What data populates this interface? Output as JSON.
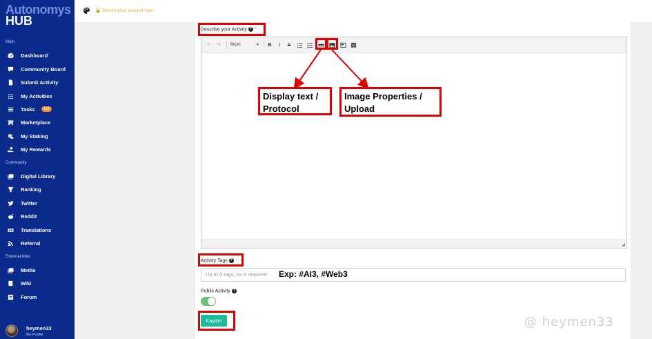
{
  "brand": {
    "line1": "Autonomys",
    "line2": "HUB"
  },
  "topbar": {
    "secure_text": "Secure your account now"
  },
  "sidebar": {
    "sections": {
      "main": "Main",
      "community": "Community",
      "external": "External links"
    },
    "items": [
      {
        "label": "Dashboard",
        "icon": "speedometer-icon"
      },
      {
        "label": "Community Board",
        "icon": "chat-icon"
      },
      {
        "label": "Submit Activity",
        "icon": "file-icon"
      },
      {
        "label": "My Activities",
        "icon": "list-icon"
      },
      {
        "label": "Tasks",
        "icon": "tasks-icon",
        "badge": "112"
      },
      {
        "label": "Marketplace",
        "icon": "store-icon"
      },
      {
        "label": "My Staking",
        "icon": "coins-icon"
      },
      {
        "label": "My Rewards",
        "icon": "hand-coin-icon"
      },
      {
        "label": "Digital Library",
        "icon": "photo-icon"
      },
      {
        "label": "Ranking",
        "icon": "trophy-icon"
      },
      {
        "label": "Twitter",
        "icon": "twitter-icon"
      },
      {
        "label": "Reddit",
        "icon": "reddit-icon"
      },
      {
        "label": "Translations",
        "icon": "translate-icon"
      },
      {
        "label": "Referral",
        "icon": "rss-icon"
      },
      {
        "label": "Media",
        "icon": "photo-icon"
      },
      {
        "label": "Wiki",
        "icon": "book-icon"
      },
      {
        "label": "Forum",
        "icon": "forum-icon"
      }
    ],
    "profile": {
      "name": "heymen33",
      "sub": "My Profile"
    }
  },
  "form": {
    "describe_label": "Describe your Activity",
    "required_mark": "*",
    "format_select": "Biçim",
    "tags_label": "Activity Tags",
    "tags_placeholder": "Up to 6 tags, no # required",
    "public_label": "Public Activity",
    "public_on": true,
    "save_label": "Kaydet"
  },
  "annotations": {
    "display_text": "Display text / Protocol",
    "image_props": "Image Properties / Upload",
    "tags_example": "Exp: #AI3, #Web3",
    "color": "#e00000"
  },
  "watermark": "@ heymen33"
}
